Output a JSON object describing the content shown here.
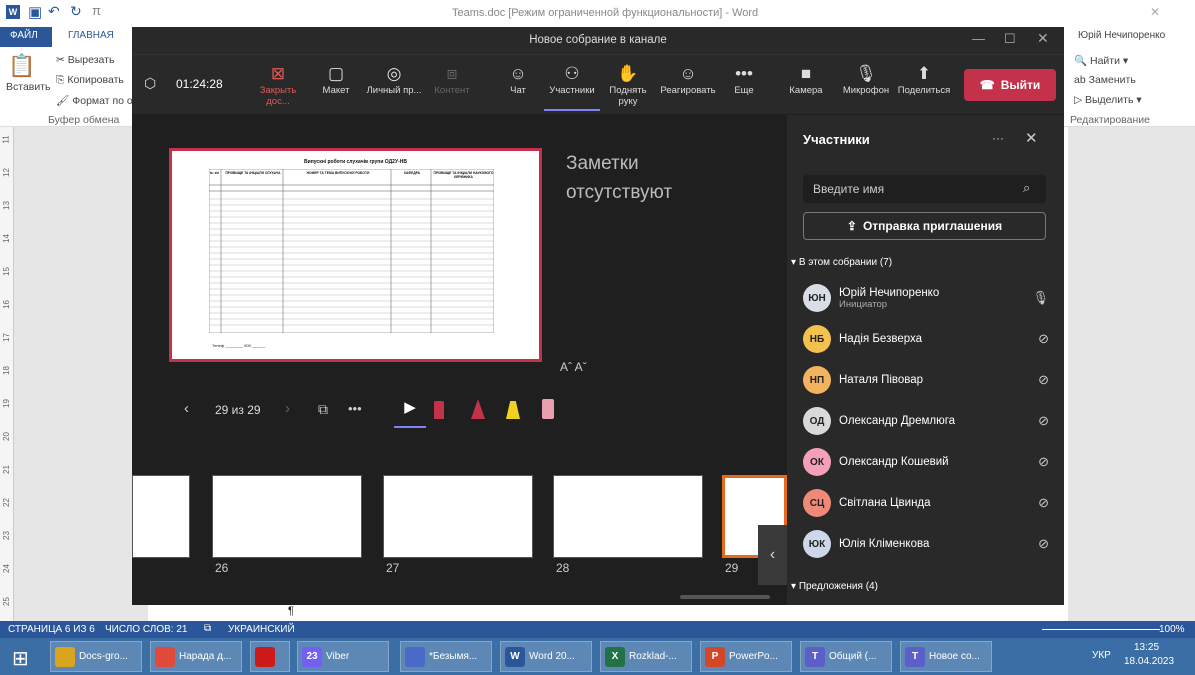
{
  "word": {
    "title": "Teams.doc [Режим ограниченной функциональности] - Word",
    "user": "Юрій Нечипоренко",
    "tabs": [
      "ФАЙЛ",
      "ГЛАВНАЯ"
    ],
    "clipboard": {
      "paste": "Вставить",
      "cut": "Вырезать",
      "copy": "Копировать",
      "format": "Формат по о",
      "group": "Буфер обмена"
    },
    "editing": {
      "find": "Найти",
      "replace": "Заменить",
      "select": "Выделить",
      "group": "Редактирование"
    },
    "ruler_numbers": [
      "11",
      "12",
      "13",
      "14",
      "15",
      "16",
      "17",
      "18",
      "19",
      "20",
      "21",
      "22",
      "23",
      "24",
      "25"
    ],
    "pilcrow": "¶"
  },
  "status": {
    "page": "СТРАНИЦА 6 ИЗ 6",
    "words": "ЧИСЛО СЛОВ: 21",
    "lang": "УКРАИНСКИЙ",
    "zoom": "100%"
  },
  "taskbar": {
    "items": [
      {
        "label": "Docs-gro...",
        "color": "#d9a520",
        "icon": ""
      },
      {
        "label": "Нарада д...",
        "color": "#e04a3a",
        "icon": ""
      },
      {
        "label": "",
        "color": "#cc1a1a",
        "icon": ""
      },
      {
        "label": "Viber",
        "color": "#7360f2",
        "icon": "23"
      },
      {
        "label": "*Безымя...",
        "color": "#4a6ac8",
        "icon": ""
      },
      {
        "label": "Word 20...",
        "color": "#2b579a",
        "icon": "W"
      },
      {
        "label": "Rozklad-...",
        "color": "#217346",
        "icon": "X"
      },
      {
        "label": "PowerPo...",
        "color": "#d24726",
        "icon": "P"
      },
      {
        "label": "Общий (...",
        "color": "#5b5fc7",
        "icon": "T"
      },
      {
        "label": "Новое со...",
        "color": "#5b5fc7",
        "icon": "T"
      }
    ],
    "lang": "УКР",
    "time": "13:25",
    "date": "18.04.2023"
  },
  "teams": {
    "title": "Новое собрание в канале",
    "timer": "01:24:28",
    "toolbar": [
      {
        "label": "Закрыть дос...",
        "icon": "⊠",
        "red": true
      },
      {
        "label": "Макет",
        "icon": "▢",
        "red": false
      },
      {
        "label": "Личный пр...",
        "icon": "◎",
        "red": false
      },
      {
        "label": "Контент",
        "icon": "⧈",
        "red": false,
        "dim": true
      },
      {
        "label": "Чат",
        "icon": "☺",
        "red": false
      },
      {
        "label": "Участники",
        "icon": "⚇",
        "red": false,
        "active": true
      },
      {
        "label": "Поднять руку",
        "icon": "✋",
        "red": false
      },
      {
        "label": "Реагировать",
        "icon": "☺",
        "red": false
      },
      {
        "label": "Еще",
        "icon": "•••",
        "red": false
      },
      {
        "label": "Камера",
        "icon": "■",
        "red": false
      },
      {
        "label": "Микрофон",
        "icon": "🎙",
        "red": false
      },
      {
        "label": "Поделиться",
        "icon": "⬆",
        "red": false
      }
    ],
    "leave_label": "Выйти",
    "notes": "Заметки отсутствуют",
    "font_controls": "Aˆ Aˇ",
    "slide_counter": "29 из 29",
    "thumbnails": [
      "26",
      "27",
      "28",
      "29"
    ],
    "slide": {
      "heading": "Випускні роботи слухачів групи ОД2У-НВ",
      "cols": [
        "№ з/п",
        "ПРІЗВИЩЕ ТА ІНІЦІАЛИ СЛУХАЧА",
        "НОМЕР ТА ТЕМА ВИПУСКНОЇ РОБОТИ",
        "КАФЕДРА",
        "ПРІЗВИЩЕ ТА ІНІЦІАЛИ НАУКОВОГО КЕРІВНИКА"
      ],
      "footer": "Телеф ________ 000 ______"
    },
    "participants": {
      "title": "Участники",
      "search_placeholder": "Введите имя",
      "invite": "Отправка приглашения",
      "in_meeting": "В этом собрании (7)",
      "suggestions": "Предложения (4)",
      "list": [
        {
          "initials": "ЮН",
          "name": "Юрій Нечипоренко",
          "role": "Инициатор",
          "color": "#d8dde6",
          "muted": false
        },
        {
          "initials": "НБ",
          "name": "Надія Безверха",
          "role": "",
          "color": "#f2c14e",
          "muted": true
        },
        {
          "initials": "НП",
          "name": "Наталя Півовар",
          "role": "",
          "color": "#f2b35e",
          "muted": true
        },
        {
          "initials": "ОД",
          "name": "Олександр Дремлюга",
          "role": "",
          "color": "#d9d9d9",
          "muted": true
        },
        {
          "initials": "ОК",
          "name": "Олександр Кошевий",
          "role": "",
          "color": "#f4a0b8",
          "muted": true
        },
        {
          "initials": "СЦ",
          "name": "Світлана Цвинда",
          "role": "",
          "color": "#f08a78",
          "muted": true
        },
        {
          "initials": "ЮК",
          "name": "Юлія Кліменкова",
          "role": "",
          "color": "#cfd8ea",
          "muted": true
        }
      ]
    }
  }
}
